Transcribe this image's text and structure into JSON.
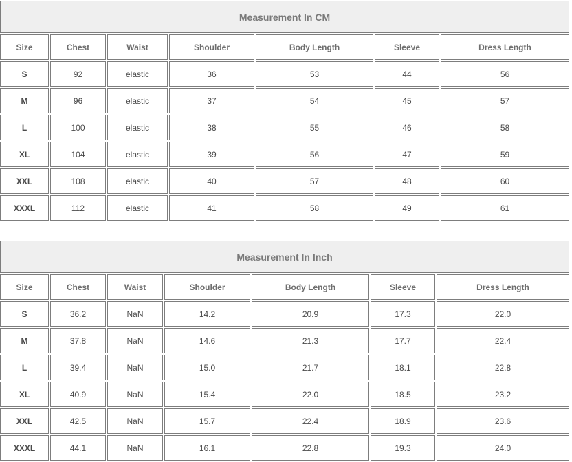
{
  "tables": [
    {
      "title": "Measurement In CM",
      "headers": [
        "Size",
        "Chest",
        "Waist",
        "Shoulder",
        "Body Length",
        "Sleeve",
        "Dress Length"
      ],
      "rows": [
        [
          "S",
          "92",
          "elastic",
          "36",
          "53",
          "44",
          "56"
        ],
        [
          "M",
          "96",
          "elastic",
          "37",
          "54",
          "45",
          "57"
        ],
        [
          "L",
          "100",
          "elastic",
          "38",
          "55",
          "46",
          "58"
        ],
        [
          "XL",
          "104",
          "elastic",
          "39",
          "56",
          "47",
          "59"
        ],
        [
          "XXL",
          "108",
          "elastic",
          "40",
          "57",
          "48",
          "60"
        ],
        [
          "XXXL",
          "112",
          "elastic",
          "41",
          "58",
          "49",
          "61"
        ]
      ]
    },
    {
      "title": "Measurement In Inch",
      "headers": [
        "Size",
        "Chest",
        "Waist",
        "Shoulder",
        "Body Length",
        "Sleeve",
        "Dress Length"
      ],
      "rows": [
        [
          "S",
          "36.2",
          "NaN",
          "14.2",
          "20.9",
          "17.3",
          "22.0"
        ],
        [
          "M",
          "37.8",
          "NaN",
          "14.6",
          "21.3",
          "17.7",
          "22.4"
        ],
        [
          "L",
          "39.4",
          "NaN",
          "15.0",
          "21.7",
          "18.1",
          "22.8"
        ],
        [
          "XL",
          "40.9",
          "NaN",
          "15.4",
          "22.0",
          "18.5",
          "23.2"
        ],
        [
          "XXL",
          "42.5",
          "NaN",
          "15.7",
          "22.4",
          "18.9",
          "23.6"
        ],
        [
          "XXXL",
          "44.1",
          "NaN",
          "16.1",
          "22.8",
          "19.3",
          "24.0"
        ]
      ]
    }
  ]
}
